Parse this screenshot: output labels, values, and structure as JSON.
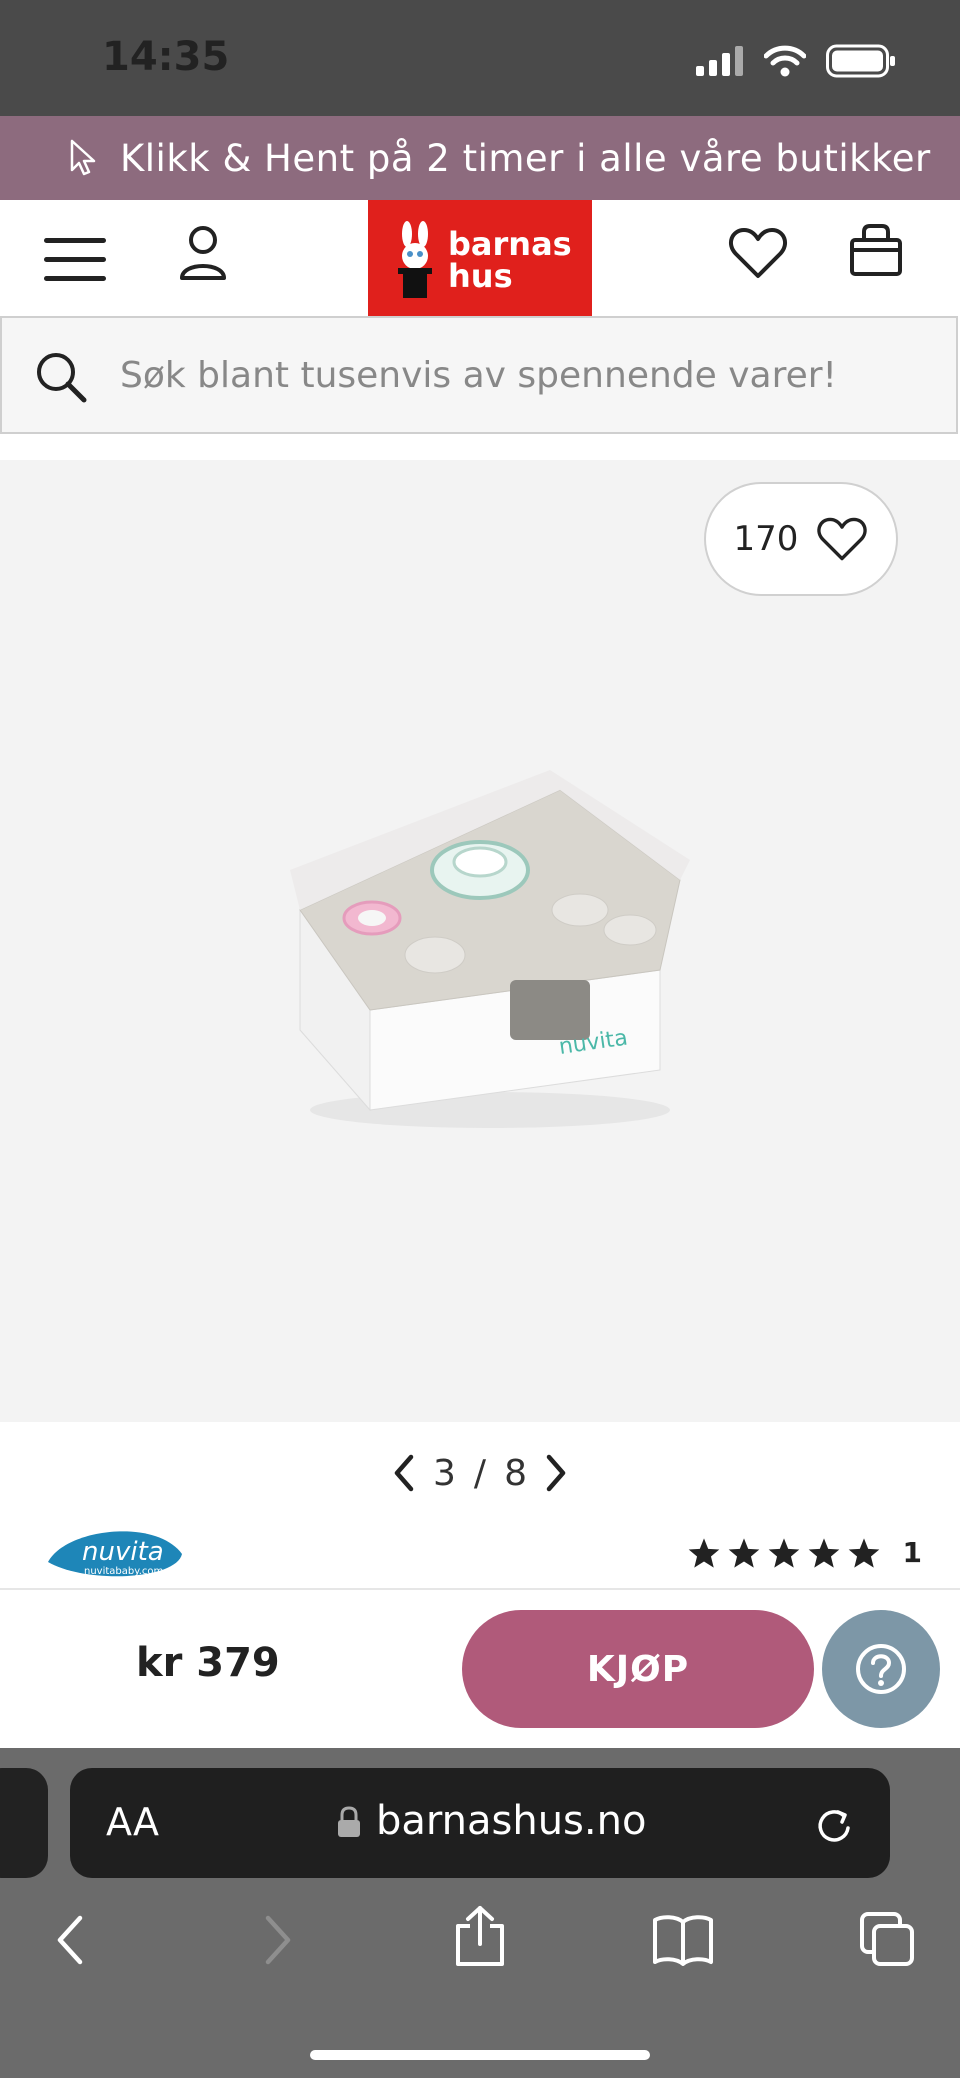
{
  "status": {
    "time": "14:35"
  },
  "promo": {
    "text": "Klikk & Hent på 2 timer i alle våre butikker"
  },
  "header": {
    "logo_line1": "barnas",
    "logo_line2": "hus"
  },
  "search": {
    "placeholder": "Søk blant tusenvis av spennende varer!"
  },
  "product": {
    "likes": "170",
    "pager_current": "3",
    "pager_separator": "/",
    "pager_total": "8",
    "brand_logo_text": "nuvita",
    "brand_logo_sub": "nuvitababy.com",
    "image_brand_text": "nuvita",
    "rating_stars": 5,
    "rating_count": "1"
  },
  "buy": {
    "price": "kr 379",
    "button_label": "KJØP"
  },
  "browser": {
    "aa": "AA",
    "url": "barnashus.no"
  },
  "colors": {
    "promo": "#8d6b7e",
    "logo": "#e0201c",
    "buy": "#b05a7a",
    "help": "#7d97a7"
  }
}
